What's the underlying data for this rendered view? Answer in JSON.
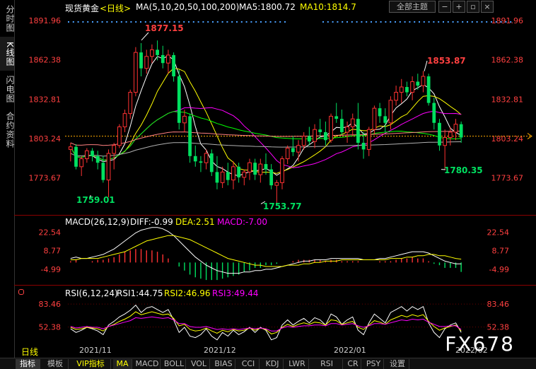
{
  "side_tabs": [
    {
      "label": "分时图",
      "active": false
    },
    {
      "label": "K线图",
      "active": true
    },
    {
      "label": "闪电图",
      "active": false
    },
    {
      "label": "合约资料",
      "active": false
    }
  ],
  "header": {
    "instrument": "现货黄金",
    "period": "<日线>",
    "ma_label": "MA(5,10,20,50,100,200)",
    "ma5": "MA5:1800.72",
    "ma10": "MA10:1814.7",
    "theme_button": "全部主题"
  },
  "macd_header": {
    "label": "MACD(26,12,9)",
    "diff": "DIFF:-0.99",
    "dea": "DEA:2.51",
    "macd": "MACD:-7.00"
  },
  "rsi_header": {
    "label": "RSI(6,12,24)",
    "rsi1": "RSI1:44.75",
    "rsi2": "RSI2:46.96",
    "rsi3": "RSI3:49.44"
  },
  "colors": {
    "up": "#ff3232",
    "down": "#00e060",
    "ma5": "#ffffff",
    "ma10": "#ffff00",
    "ma20": "#ff00ff",
    "ma50": "#00ff00",
    "ma100": "#ff8080",
    "ma200": "#b0b0b0"
  },
  "date_labels": [
    "2021/11",
    "2021/12",
    "2022/01",
    "2022/02"
  ],
  "bottom": {
    "period_label": "日线",
    "tabs": [
      "指标",
      "模板",
      "VIP指标",
      "MA",
      "MACD",
      "BOLL",
      "VOL",
      "BIAS",
      "CCI",
      "KDJ",
      "LWR",
      "RSI",
      "CR",
      "PSY",
      "设置"
    ],
    "active_tab": "MA"
  },
  "watermark": "FX678",
  "chart_data": [
    {
      "type": "candlestick",
      "title": "现货黄金 <日线>",
      "ylim": [
        1750,
        1900
      ],
      "y_ticks": [
        "1891.96",
        "1862.38",
        "1832.81",
        "1803.24",
        "1773.67"
      ],
      "current_price": 1805,
      "annotations": [
        {
          "label": "1877.15",
          "value": 1877.15,
          "type": "high"
        },
        {
          "label": "1759.01",
          "value": 1759.01,
          "type": "low"
        },
        {
          "label": "1753.77",
          "value": 1753.77,
          "type": "low"
        },
        {
          "label": "1853.87",
          "value": 1853.87,
          "type": "high"
        },
        {
          "label": "1780.35",
          "value": 1780.35,
          "type": "low"
        }
      ],
      "ohlc": [
        [
          1795,
          1800,
          1786,
          1797
        ],
        [
          1797,
          1799,
          1780,
          1782
        ],
        [
          1782,
          1790,
          1775,
          1788
        ],
        [
          1788,
          1796,
          1785,
          1794
        ],
        [
          1794,
          1796,
          1786,
          1790
        ],
        [
          1790,
          1794,
          1780,
          1785
        ],
        [
          1785,
          1790,
          1770,
          1772
        ],
        [
          1772,
          1795,
          1759,
          1792
        ],
        [
          1792,
          1800,
          1780,
          1798
        ],
        [
          1798,
          1814,
          1796,
          1812
        ],
        [
          1812,
          1825,
          1808,
          1822
        ],
        [
          1822,
          1840,
          1818,
          1838
        ],
        [
          1838,
          1872,
          1835,
          1868
        ],
        [
          1868,
          1875,
          1850,
          1856
        ],
        [
          1856,
          1870,
          1852,
          1865
        ],
        [
          1865,
          1874,
          1860,
          1870
        ],
        [
          1870,
          1877,
          1862,
          1866
        ],
        [
          1866,
          1873,
          1856,
          1860
        ],
        [
          1860,
          1870,
          1852,
          1866
        ],
        [
          1866,
          1868,
          1846,
          1850
        ],
        [
          1850,
          1855,
          1810,
          1815
        ],
        [
          1815,
          1825,
          1808,
          1820
        ],
        [
          1820,
          1822,
          1785,
          1790
        ],
        [
          1790,
          1798,
          1782,
          1786
        ],
        [
          1786,
          1790,
          1778,
          1785
        ],
        [
          1785,
          1795,
          1780,
          1792
        ],
        [
          1792,
          1795,
          1775,
          1778
        ],
        [
          1778,
          1790,
          1765,
          1770
        ],
        [
          1770,
          1782,
          1766,
          1778
        ],
        [
          1778,
          1785,
          1768,
          1772
        ],
        [
          1772,
          1786,
          1765,
          1782
        ],
        [
          1782,
          1785,
          1770,
          1774
        ],
        [
          1774,
          1780,
          1768,
          1778
        ],
        [
          1778,
          1788,
          1772,
          1785
        ],
        [
          1785,
          1788,
          1772,
          1776
        ],
        [
          1776,
          1788,
          1770,
          1784
        ],
        [
          1784,
          1792,
          1776,
          1780
        ],
        [
          1780,
          1784,
          1765,
          1768
        ],
        [
          1768,
          1772,
          1754,
          1770
        ],
        [
          1770,
          1790,
          1765,
          1788
        ],
        [
          1788,
          1798,
          1784,
          1796
        ],
        [
          1796,
          1805,
          1790,
          1793
        ],
        [
          1793,
          1802,
          1786,
          1798
        ],
        [
          1798,
          1808,
          1795,
          1805
        ],
        [
          1805,
          1812,
          1798,
          1801
        ],
        [
          1801,
          1814,
          1796,
          1810
        ],
        [
          1810,
          1818,
          1804,
          1808
        ],
        [
          1808,
          1816,
          1798,
          1802
        ],
        [
          1802,
          1822,
          1800,
          1820
        ],
        [
          1820,
          1830,
          1815,
          1818
        ],
        [
          1818,
          1825,
          1806,
          1808
        ],
        [
          1808,
          1816,
          1800,
          1812
        ],
        [
          1812,
          1822,
          1805,
          1818
        ],
        [
          1818,
          1830,
          1795,
          1800
        ],
        [
          1800,
          1808,
          1788,
          1795
        ],
        [
          1795,
          1812,
          1790,
          1810
        ],
        [
          1810,
          1828,
          1806,
          1826
        ],
        [
          1826,
          1830,
          1815,
          1820
        ],
        [
          1820,
          1826,
          1808,
          1815
        ],
        [
          1815,
          1835,
          1810,
          1832
        ],
        [
          1832,
          1843,
          1828,
          1838
        ],
        [
          1838,
          1848,
          1830,
          1842
        ],
        [
          1842,
          1846,
          1835,
          1838
        ],
        [
          1838,
          1850,
          1832,
          1846
        ],
        [
          1846,
          1852,
          1840,
          1843
        ],
        [
          1843,
          1854,
          1838,
          1850
        ],
        [
          1850,
          1852,
          1828,
          1830
        ],
        [
          1830,
          1834,
          1810,
          1815
        ],
        [
          1815,
          1818,
          1794,
          1798
        ],
        [
          1798,
          1810,
          1780,
          1804
        ],
        [
          1804,
          1812,
          1798,
          1808
        ],
        [
          1808,
          1818,
          1802,
          1814
        ],
        [
          1814,
          1816,
          1800,
          1804
        ]
      ]
    },
    {
      "type": "bar+line",
      "title": "MACD(26,12,9)",
      "y_ticks": [
        "22.54",
        "8.77",
        "-4.99"
      ],
      "ylim": [
        -14,
        28
      ],
      "series": [
        {
          "name": "DIFF",
          "values": [
            3,
            4,
            3,
            3,
            4,
            5,
            6,
            8,
            10,
            13,
            16,
            19,
            22,
            24,
            25,
            26,
            26,
            25,
            23,
            20,
            16,
            12,
            8,
            4,
            1,
            -2,
            -4,
            -6,
            -7,
            -8,
            -8,
            -8,
            -7,
            -7,
            -6,
            -6,
            -5,
            -5,
            -4,
            -3,
            -2,
            -1,
            0,
            1,
            1,
            2,
            2,
            2,
            3,
            3,
            3,
            3,
            3,
            3,
            2,
            2,
            2,
            3,
            3,
            4,
            5,
            6,
            7,
            8,
            8,
            8,
            7,
            5,
            3,
            1,
            0,
            -1,
            -1
          ]
        },
        {
          "name": "DEA",
          "values": [
            2,
            2,
            3,
            3,
            3,
            3,
            4,
            5,
            6,
            7,
            8,
            10,
            12,
            14,
            16,
            17,
            18,
            19,
            20,
            20,
            19,
            18,
            17,
            15,
            13,
            11,
            9,
            7,
            5,
            3,
            2,
            1,
            0,
            -1,
            -2,
            -2,
            -3,
            -3,
            -3,
            -3,
            -2,
            -2,
            -2,
            -1,
            -1,
            0,
            0,
            1,
            1,
            1,
            2,
            2,
            2,
            2,
            2,
            2,
            2,
            2,
            2,
            3,
            3,
            3,
            4,
            4,
            5,
            5,
            6,
            6,
            5,
            5,
            4,
            3,
            2.5
          ]
        },
        {
          "name": "MACD",
          "values": [
            1,
            2,
            0,
            0,
            1,
            2,
            2,
            3,
            4,
            6,
            8,
            9,
            10,
            10,
            9,
            9,
            8,
            6,
            3,
            0,
            -3,
            -6,
            -9,
            -11,
            -12,
            -13,
            -13,
            -13,
            -12,
            -11,
            -10,
            -9,
            -7,
            -6,
            -4,
            -4,
            -2,
            -2,
            -1,
            0,
            0,
            1,
            2,
            2,
            2,
            2,
            2,
            1,
            2,
            2,
            1,
            1,
            1,
            1,
            0,
            0,
            0,
            1,
            1,
            1,
            2,
            3,
            3,
            4,
            3,
            3,
            1,
            -1,
            -2,
            -4,
            -4,
            -4,
            -7
          ]
        }
      ]
    },
    {
      "type": "line",
      "title": "RSI(6,12,24)",
      "y_ticks": [
        "83.46",
        "52.38"
      ],
      "ylim": [
        30,
        95
      ],
      "series": [
        {
          "name": "RSI1",
          "values": [
            50,
            45,
            48,
            52,
            50,
            47,
            42,
            55,
            60,
            66,
            70,
            75,
            82,
            72,
            78,
            80,
            76,
            72,
            76,
            62,
            45,
            52,
            40,
            38,
            42,
            50,
            40,
            35,
            45,
            40,
            48,
            42,
            46,
            52,
            45,
            52,
            48,
            35,
            38,
            55,
            62,
            55,
            60,
            64,
            58,
            65,
            62,
            55,
            70,
            66,
            56,
            62,
            66,
            48,
            42,
            58,
            70,
            64,
            58,
            72,
            76,
            80,
            74,
            80,
            76,
            80,
            58,
            45,
            38,
            50,
            55,
            58,
            45
          ]
        },
        {
          "name": "RSI2",
          "values": [
            52,
            49,
            50,
            52,
            51,
            50,
            47,
            53,
            56,
            60,
            63,
            67,
            73,
            69,
            71,
            73,
            71,
            69,
            70,
            64,
            54,
            56,
            49,
            47,
            48,
            51,
            47,
            44,
            48,
            46,
            49,
            47,
            48,
            51,
            48,
            51,
            49,
            43,
            45,
            52,
            56,
            53,
            56,
            58,
            56,
            59,
            58,
            55,
            62,
            61,
            56,
            58,
            60,
            52,
            49,
            55,
            61,
            59,
            56,
            62,
            65,
            68,
            66,
            69,
            67,
            69,
            60,
            53,
            48,
            51,
            53,
            55,
            47
          ]
        },
        {
          "name": "RSI3",
          "values": [
            53,
            51,
            52,
            53,
            52,
            52,
            50,
            53,
            55,
            57,
            59,
            61,
            65,
            64,
            65,
            66,
            65,
            64,
            65,
            62,
            57,
            57,
            53,
            52,
            52,
            53,
            51,
            49,
            50,
            49,
            50,
            49,
            50,
            51,
            50,
            51,
            50,
            47,
            47,
            51,
            53,
            52,
            53,
            54,
            54,
            55,
            55,
            54,
            57,
            57,
            55,
            56,
            57,
            54,
            52,
            54,
            57,
            57,
            56,
            58,
            60,
            62,
            61,
            63,
            62,
            63,
            59,
            56,
            53,
            53,
            54,
            54,
            49
          ]
        }
      ]
    }
  ]
}
